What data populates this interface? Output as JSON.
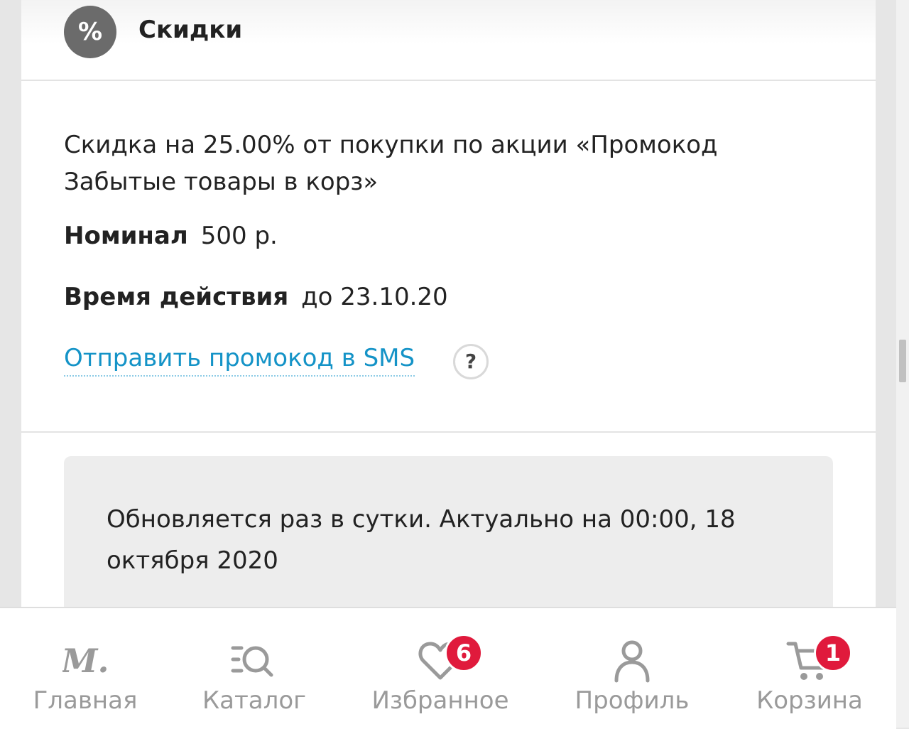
{
  "section": {
    "title": "Скидки",
    "badge_symbol": "%"
  },
  "promo": {
    "description": "Скидка на 25.00% от покупки по акции «Промокод Забытые товары в корз»",
    "nominal_label": "Номинал",
    "nominal_value": "500 р.",
    "validity_label": "Время действия",
    "validity_value": "до 23.10.20",
    "sms_link": "Отправить промокод в SMS",
    "help_symbol": "?"
  },
  "info": {
    "text": "Обновляется раз в сутки. Актуально на 00:00, 18 октября 2020"
  },
  "bottom_nav": {
    "items": [
      {
        "label": "Главная",
        "icon": "logo-m-icon"
      },
      {
        "label": "Каталог",
        "icon": "catalog-search-icon"
      },
      {
        "label": "Избранное",
        "icon": "heart-icon",
        "badge": "6"
      },
      {
        "label": "Профиль",
        "icon": "user-icon"
      },
      {
        "label": "Корзина",
        "icon": "cart-icon",
        "badge": "1"
      }
    ]
  },
  "colors": {
    "link": "#1493c7",
    "badge": "#e01a3c",
    "nav_inactive": "#9a9a9a"
  }
}
